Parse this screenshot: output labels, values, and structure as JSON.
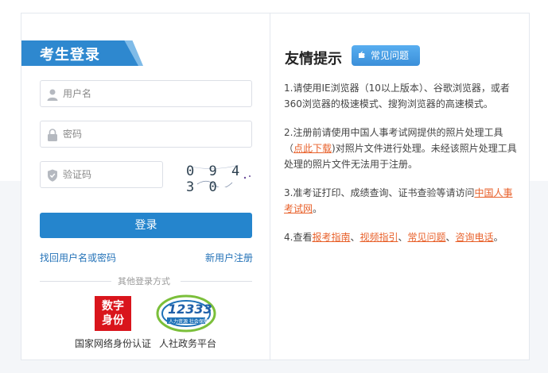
{
  "login": {
    "title": "考生登录",
    "username_placeholder": "用户名",
    "password_placeholder": "密码",
    "captcha_placeholder": "验证码",
    "captcha_text": "0 9 4 3 0",
    "submit_label": "登录",
    "forgot_label": "找回用户名或密码",
    "register_label": "新用户注册",
    "other_methods_label": "其他登录方式",
    "digital_id_logo": "数字身份",
    "digital_id_caption": "国家网络身份认证",
    "hrss_logo_number": "12333",
    "hrss_logo_sub": "人力资源  社会保障",
    "hrss_caption": "人社政务平台"
  },
  "tips": {
    "title": "友情提示",
    "faq_badge": "常见问题",
    "item1": "1.请使用IE浏览器（10以上版本）、谷歌浏览器，或者360浏览器的极速模式、搜狗浏览器的高速模式。",
    "item2_pre": "2.注册前请使用中国人事考试网提供的照片处理工具（",
    "item2_link": "点此下载",
    "item2_post": ")对照片文件进行处理。未经该照片处理工具处理的照片文件无法用于注册。",
    "item3_pre": "3.准考证打印、成绩查询、证书查验等请访问",
    "item3_link": "中国人事考试网",
    "item3_post": "。",
    "item4_pre": "4.查看",
    "item4_link1": "报考指南",
    "item4_sep1": "、",
    "item4_link2": "视频指引",
    "item4_sep2": "、",
    "item4_link3": "常见问题",
    "item4_sep3": "、",
    "item4_link4": "咨询电话",
    "item4_post": "。"
  },
  "colors": {
    "primary": "#2585cd",
    "link": "#e8612b",
    "brand_red": "#d9151c"
  }
}
